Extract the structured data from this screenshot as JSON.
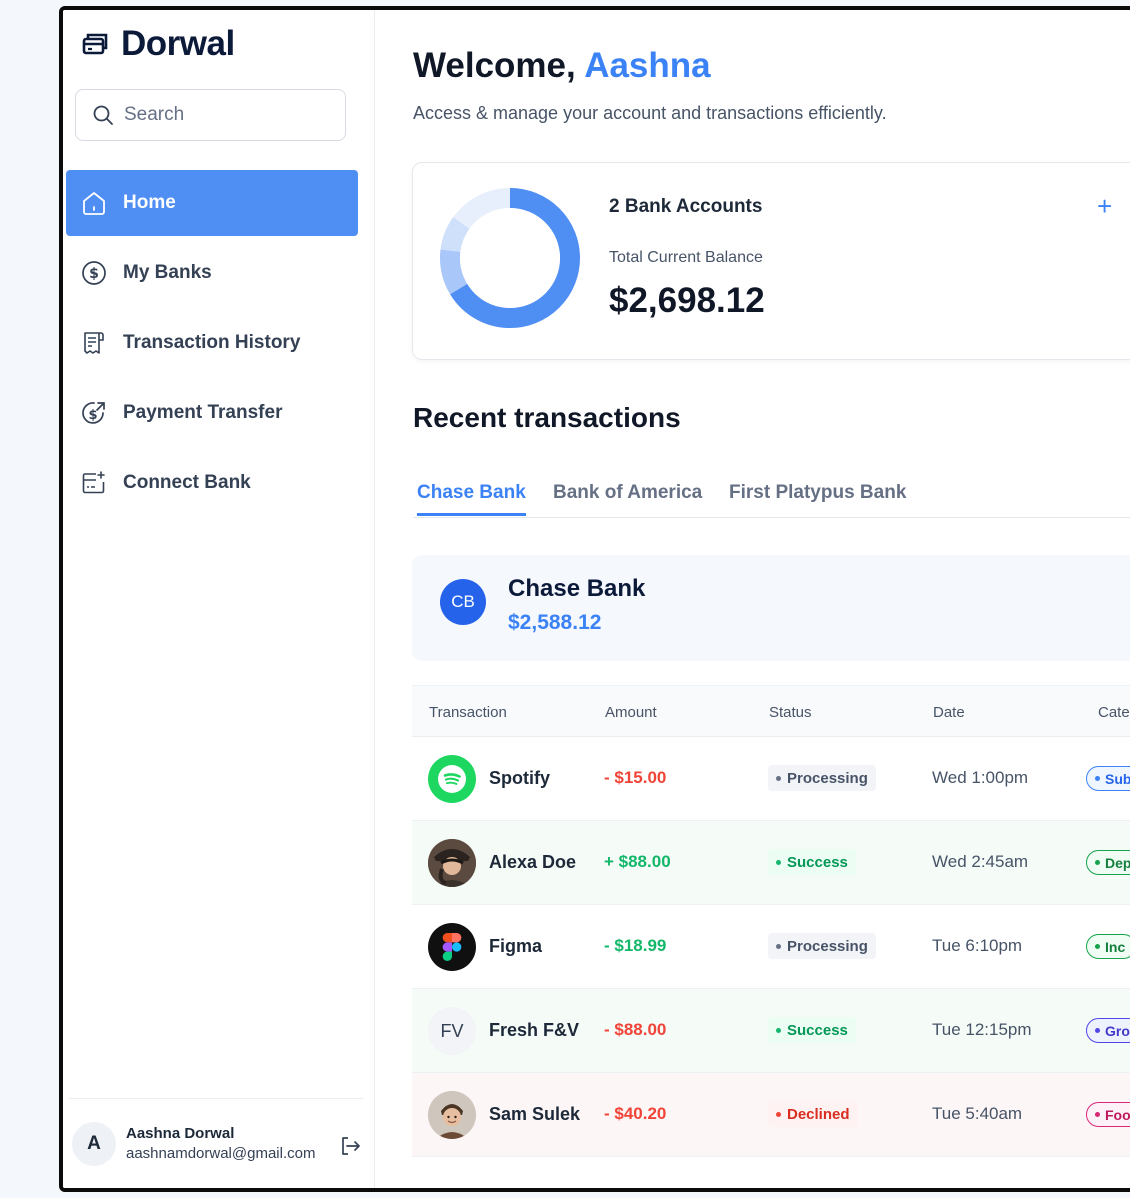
{
  "brand": {
    "name": "Dorwal",
    "icon": "card-icon"
  },
  "search": {
    "placeholder": "Search"
  },
  "nav": [
    {
      "label": "Home",
      "icon": "home-icon",
      "active": true
    },
    {
      "label": "My Banks",
      "icon": "dollar-circle-icon"
    },
    {
      "label": "Transaction History",
      "icon": "receipt-icon"
    },
    {
      "label": "Payment Transfer",
      "icon": "money-send-icon"
    },
    {
      "label": "Connect Bank",
      "icon": "bank-add-icon"
    }
  ],
  "user": {
    "initial": "A",
    "name": "Aashna Dorwal",
    "email": "aashnamdorwal@gmail.com"
  },
  "header": {
    "greeting": "Welcome,",
    "name": "Aashna",
    "subtitle": "Access & manage your account and transactions efficiently."
  },
  "balance": {
    "accounts": "2 Bank Accounts",
    "label": "Total Current Balance",
    "amount": "$2,698.12",
    "add": "+"
  },
  "recent": {
    "title": "Recent transactions",
    "tabs": [
      "Chase Bank",
      "Bank of America",
      "First Platypus Bank"
    ],
    "bank": {
      "initials": "CB",
      "name": "Chase Bank",
      "balance": "$2,588.12"
    },
    "columns": [
      "Transaction",
      "Amount",
      "Status",
      "Date",
      "Cate"
    ],
    "rows": [
      {
        "name": "Spotify",
        "amount": "- $15.00",
        "status": "Processing",
        "date": "Wed 1:00pm",
        "category": "Sub",
        "tone": "plain"
      },
      {
        "name": "Alexa Doe",
        "amount": "+ $88.00",
        "status": "Success",
        "date": "Wed 2:45am",
        "category": "Dep",
        "tone": "green"
      },
      {
        "name": "Figma",
        "amount": "- $18.99",
        "status": "Processing",
        "date": "Tue 6:10pm",
        "category": "Inc",
        "tone": "plain"
      },
      {
        "name": "Fresh F&V",
        "initials": "FV",
        "amount": "- $88.00",
        "status": "Success",
        "date": "Tue 12:15pm",
        "category": "Gro",
        "tone": "green"
      },
      {
        "name": "Sam Sulek",
        "amount": "- $40.20",
        "status": "Declined",
        "date": "Tue 5:40am",
        "category": "Foo",
        "tone": "red"
      }
    ]
  },
  "colors": {
    "accent": "#3b82f6",
    "navActive": "#4f8ef3",
    "negative": "#f04438",
    "positive": "#12b76a"
  }
}
